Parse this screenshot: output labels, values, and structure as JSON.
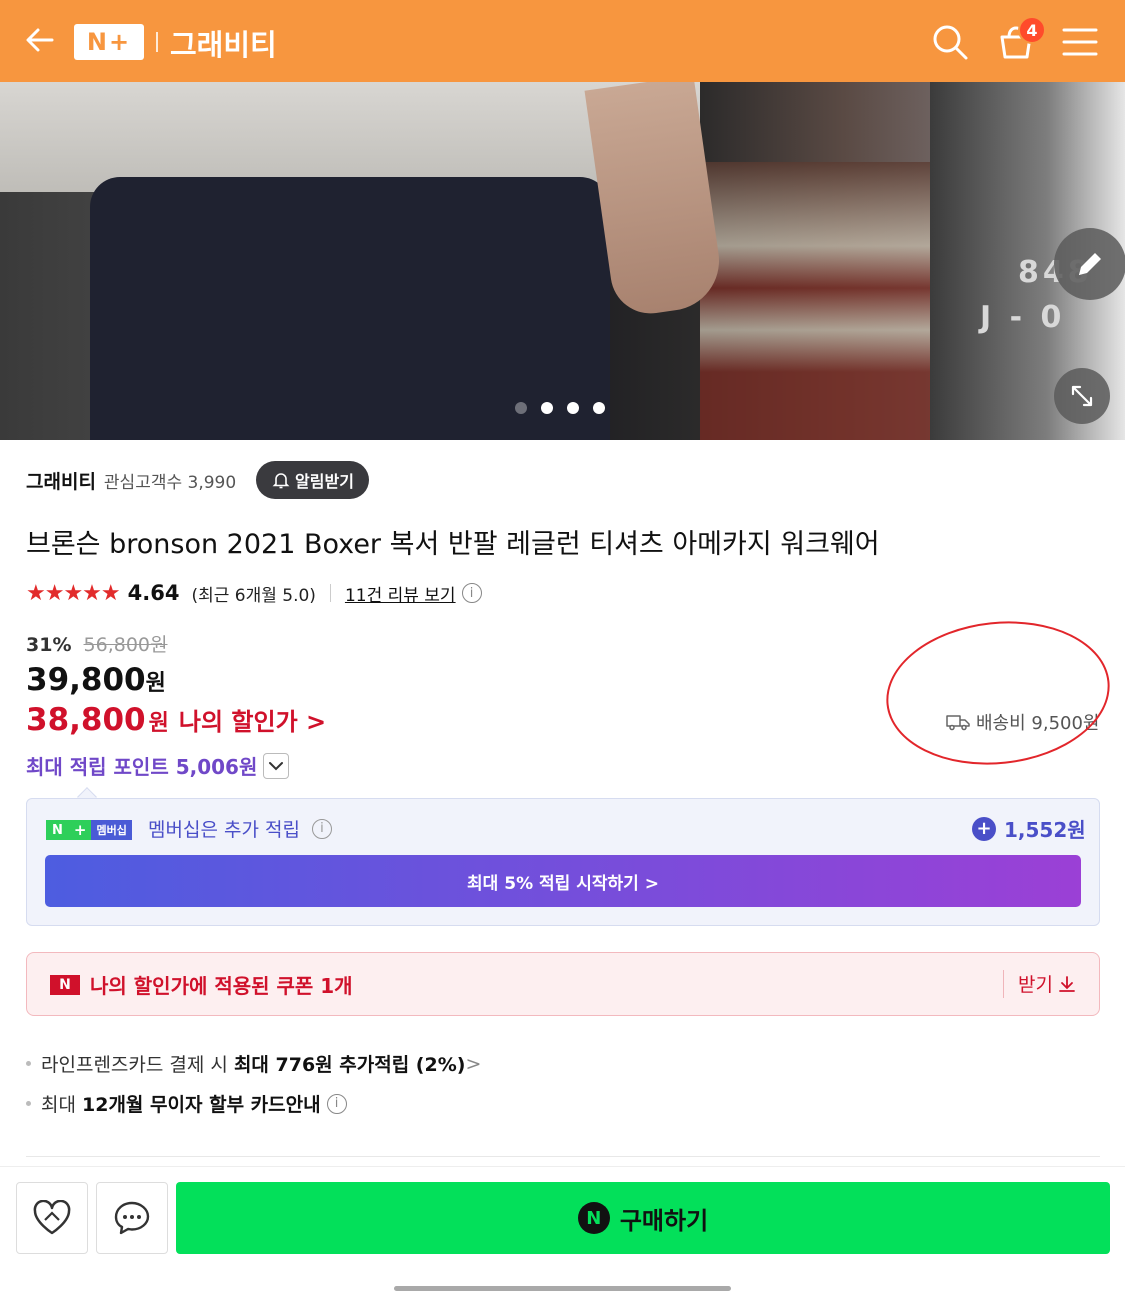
{
  "header": {
    "logo_text": "N+",
    "store_name": "그래비티",
    "cart_count": "4",
    "bg_color": "#f7963f"
  },
  "hero": {
    "image_text_1": "848",
    "image_text_2": "J - 0",
    "carousel_dots": 4,
    "active_dot": 1
  },
  "store": {
    "name": "그래비티",
    "followers_label": "관심고객수 3,990",
    "alarm_label": "알림받기"
  },
  "product": {
    "title": "브론슨 bronson 2021 Boxer 복서 반팔 레글런 티셔츠 아메카지 워크웨어",
    "stars": "★★★★★",
    "rating": "4.64",
    "recent_rating": "(최근 6개월 5.0)",
    "review_link": "11건 리뷰 보기",
    "discount_rate": "31%",
    "original_price": "56,800원",
    "price": "39,800",
    "price_unit": "원",
    "my_price": "38,800",
    "my_price_unit": "원",
    "my_price_label": "나의 할인가 >",
    "shipping": "배송비 9,500원",
    "points": "최대 적립 포인트 5,006원"
  },
  "membership": {
    "logo_n": "N",
    "logo_plus": "+",
    "logo_label": "멤버십",
    "label": "멤버십은 추가 적립",
    "extra_points": "1,552원",
    "cta": "최대 5% 적립 시작하기 >"
  },
  "coupon": {
    "logo": "N",
    "text": "나의 할인가에 적용된 쿠폰 1개",
    "get_label": "받기"
  },
  "benefits": [
    {
      "prefix": "라인프렌즈카드 결제 시 ",
      "strong": "최대 776원 추가적립 (2%)",
      "suffix": " >"
    },
    {
      "prefix": "최대 ",
      "strong": "12개월 무이자 할부 카드안내",
      "suffix": ""
    }
  ],
  "bottom": {
    "buy_logo": "N",
    "buy_label": "구매하기",
    "buy_color": "#03e05a"
  },
  "colors": {
    "discount_red": "#d0112b",
    "point_purple": "#7048c8",
    "star_red": "#e22b2b",
    "annotation_red": "#e2262b"
  }
}
